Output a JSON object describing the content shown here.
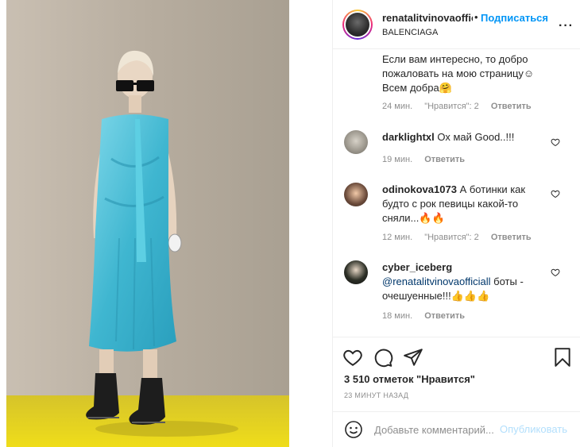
{
  "header": {
    "username": "renatalitvinovaofficial",
    "dot": "•",
    "follow_label": "Подписаться",
    "location": "BALENCIAGA",
    "more_icon": "more-dots-icon",
    "more_glyph": "···"
  },
  "comments": [
    {
      "text_lines": [
        "Если вам интересно, то добро",
        "пожаловать на мою страницу☺",
        "Всем добра🤗"
      ],
      "time": "24 мин.",
      "likes": "\"Нравится\": 2",
      "reply": "Ответить"
    },
    {
      "username": "darklightxl",
      "text": "Ох май Good..!!!",
      "time": "19 мин.",
      "reply": "Ответить"
    },
    {
      "username": "odinokova1073",
      "text_lines": [
        "А ботинки как",
        "будто с рок певицы какой-то",
        "сняли...🔥🔥"
      ],
      "time": "12 мин.",
      "likes": "\"Нравится\": 2",
      "reply": "Ответить"
    },
    {
      "username": "cyber_iceberg",
      "mention": "@renatalitvinovaofficiall",
      "text_rest": " боты -",
      "text_line2": "очешуенные!!!👍👍👍",
      "time": "18 мин.",
      "reply": "Ответить"
    }
  ],
  "actions": {
    "icons": [
      "heart-icon",
      "comment-icon",
      "share-icon",
      "bookmark-icon"
    ]
  },
  "likes_text": "3 510 отметок \"Нравится\"",
  "post_time": "23 МИНУТ НАЗАД",
  "comment_box": {
    "placeholder": "Добавьте комментарий...",
    "publish_label": "Опубликовать"
  },
  "colors": {
    "accent": "#0095f6",
    "publish_disabled": "#b2dffc",
    "dress": "#4fc3d9",
    "floor": "#e6d21e",
    "wall": "#b9aea0"
  }
}
